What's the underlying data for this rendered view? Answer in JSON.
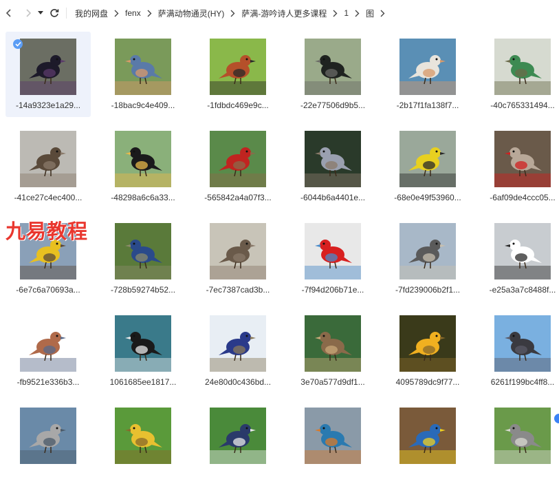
{
  "breadcrumb": [
    "我的网盘",
    "fenx",
    "萨满动物通灵(HY)",
    "萨满-游吟诗人更多课程",
    "1",
    "图"
  ],
  "watermark_text": "九易教程",
  "files": [
    {
      "name": "-14a9323e1a29...",
      "selected": true,
      "palette": [
        "#6b6e63",
        "#1d1a2a",
        "#5a3a6a"
      ]
    },
    {
      "name": "-18bac9c4e409...",
      "selected": false,
      "palette": [
        "#7a9a5a",
        "#5a7aa8",
        "#d99a6a"
      ]
    },
    {
      "name": "-1fdbdc469e9c...",
      "selected": false,
      "palette": [
        "#8ab84a",
        "#b5502a",
        "#2a2a2a"
      ]
    },
    {
      "name": "-22e77506d9b5...",
      "selected": false,
      "palette": [
        "#9aaa8a",
        "#1f2320",
        "#6a6a66"
      ]
    },
    {
      "name": "-2b17f1fa138f7...",
      "selected": false,
      "palette": [
        "#5a8fb5",
        "#e8e4dc",
        "#d89a6a"
      ]
    },
    {
      "name": "-40c765331494...",
      "selected": false,
      "palette": [
        "#d6dad0",
        "#3d8a52",
        "#6a6a4a"
      ]
    },
    {
      "name": "-41ce27c4ec400...",
      "selected": false,
      "palette": [
        "#bcbab4",
        "#5a4a3a",
        "#8a7a6a"
      ]
    },
    {
      "name": "-48298a6c6a33...",
      "selected": false,
      "palette": [
        "#8ab07a",
        "#1a1a1c",
        "#e8b84a"
      ]
    },
    {
      "name": "-565842a4a07f3...",
      "selected": false,
      "palette": [
        "#5a8a4a",
        "#c02420",
        "#8a6a4a"
      ]
    },
    {
      "name": "-6044b6a4401e...",
      "selected": false,
      "palette": [
        "#2a3a2a",
        "#9aa0b0",
        "#8a7a6a"
      ]
    },
    {
      "name": "-68e0e49f53960...",
      "selected": false,
      "palette": [
        "#9aa89a",
        "#e8d020",
        "#2a2a2a"
      ]
    },
    {
      "name": "-6af09de4ccc05...",
      "selected": false,
      "palette": [
        "#6a5a4a",
        "#b8a898",
        "#d02020"
      ]
    },
    {
      "name": "-6e7c6a70693a...",
      "selected": false,
      "palette": [
        "#8aa0b8",
        "#e8c020",
        "#5a4a3a"
      ]
    },
    {
      "name": "-728b59274b52...",
      "selected": false,
      "palette": [
        "#5a7a3a",
        "#2a4a8a",
        "#8a8a6a"
      ]
    },
    {
      "name": "-7ec7387cad3b...",
      "selected": false,
      "palette": [
        "#c8c4b8",
        "#6a5a4a",
        "#8a7a6a"
      ]
    },
    {
      "name": "-7f94d206b71e...",
      "selected": false,
      "palette": [
        "#e8e8e8",
        "#d82020",
        "#4a8ac8"
      ]
    },
    {
      "name": "-7fd239006b2f1...",
      "selected": false,
      "palette": [
        "#a8b8c8",
        "#5a5a5a",
        "#c8c0b0"
      ]
    },
    {
      "name": "-e25a3a7c8488f...",
      "selected": false,
      "palette": [
        "#c8ccd0",
        "#ffffff",
        "#2a2a2a"
      ]
    },
    {
      "name": "-fb9521e336b3...",
      "selected": false,
      "palette": [
        "#ffffff",
        "#b06a4a",
        "#5a6a8a"
      ]
    },
    {
      "name": "1061685ee1817...",
      "selected": false,
      "palette": [
        "#3a7a8a",
        "#1a1a1a",
        "#e8e8e8"
      ]
    },
    {
      "name": "24e80d0c436bd...",
      "selected": false,
      "palette": [
        "#e8eef4",
        "#2a3a8a",
        "#8a7a5a"
      ]
    },
    {
      "name": "3e70a577d9df1...",
      "selected": false,
      "palette": [
        "#3a6a3a",
        "#8a6a4a",
        "#c8a878"
      ]
    },
    {
      "name": "4095789dc9f77...",
      "selected": false,
      "palette": [
        "#3a3a1a",
        "#f0b020",
        "#8a6a2a"
      ]
    },
    {
      "name": "6261f199bc4ff8...",
      "selected": false,
      "palette": [
        "#7ab0e0",
        "#3a3a40",
        "#5a5a66"
      ]
    },
    {
      "name": "",
      "selected": false,
      "palette": [
        "#6a8aa8",
        "#a8a8a8",
        "#4a5a6a"
      ]
    },
    {
      "name": "",
      "selected": false,
      "palette": [
        "#5a9a3a",
        "#e8c030",
        "#8a6a2a"
      ]
    },
    {
      "name": "",
      "selected": false,
      "palette": [
        "#4a8a3a",
        "#2a3a6a",
        "#e8e8e8"
      ]
    },
    {
      "name": "",
      "selected": false,
      "palette": [
        "#8a9aa8",
        "#2a7ab0",
        "#d87a2a"
      ]
    },
    {
      "name": "",
      "selected": false,
      "palette": [
        "#7a5a3a",
        "#2a6ab8",
        "#f0d020"
      ]
    },
    {
      "name": "",
      "selected": false,
      "palette": [
        "#6a9a4a",
        "#8a8a8a",
        "#d8d8d0"
      ]
    }
  ]
}
